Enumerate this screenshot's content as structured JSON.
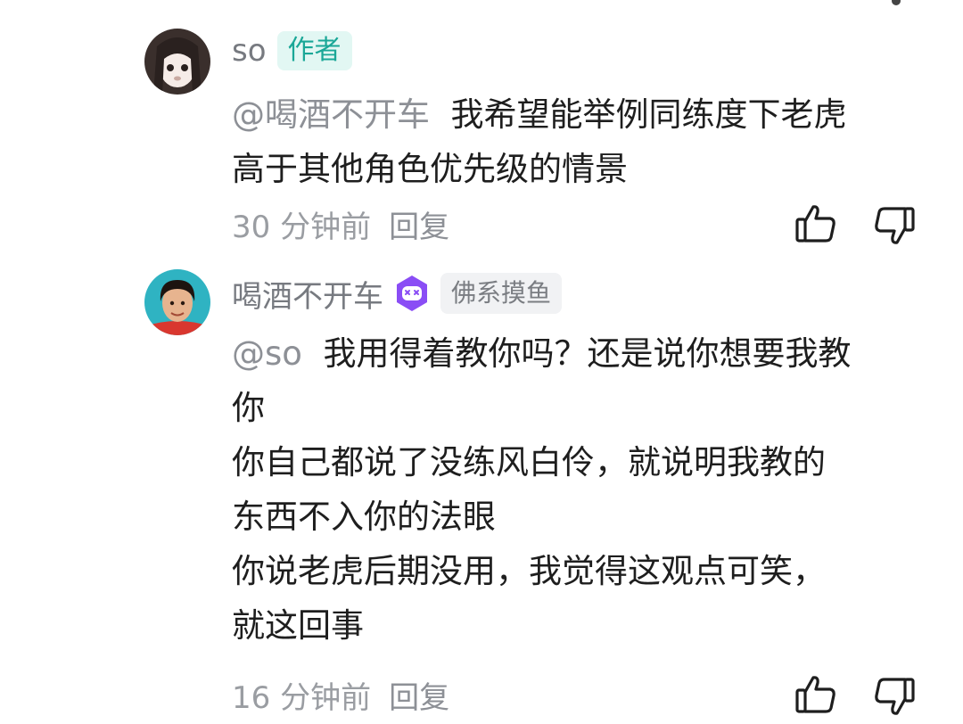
{
  "comments": [
    {
      "username": "so",
      "author_badge": "作者",
      "mention": "@喝酒不开车",
      "lines": [
        "我希望能举例同练度下老虎",
        "高于其他角色优先级的情景"
      ],
      "time": "30 分钟前",
      "reply_label": "回复"
    },
    {
      "username": "喝酒不开车",
      "tag": "佛系摸鱼",
      "mention": "@so",
      "lines": [
        "我用得着教你吗？还是说你想要我教",
        "你",
        "你自己都说了没练风白伶，就说明我教的",
        "东西不入你的法眼",
        "你说老虎后期没用，我觉得这观点可笑，",
        "就这回事"
      ],
      "time": "16 分钟前",
      "reply_label": "回复"
    }
  ],
  "icons": {
    "like": "thumbs-up-outline-icon",
    "dislike": "thumbs-down-outline-icon",
    "level": "purple-game-face-icon"
  },
  "colors": {
    "author_badge_bg": "#e2f7f3",
    "author_badge_text": "#1aa797",
    "level_icon": "#8a4df5",
    "username": "#777a80",
    "meta": "#9a9da2"
  }
}
